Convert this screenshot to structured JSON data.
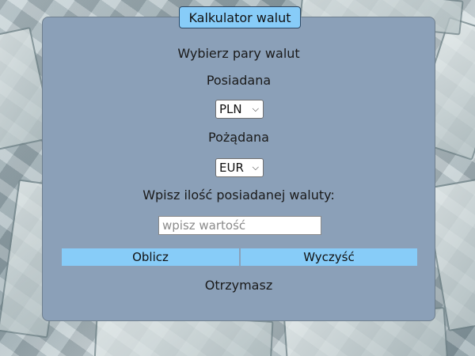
{
  "app": {
    "title": "Kalkulator walut"
  },
  "form": {
    "heading": "Wybierz pary walut",
    "have_label": "Posiadana",
    "have_value": "PLN",
    "want_label": "Pożądana",
    "want_value": "EUR",
    "amount_label": "Wpisz ilość posiadanej waluty:",
    "amount_placeholder": "wpisz wartość",
    "amount_value": "",
    "calc_button": "Oblicz",
    "clear_button": "Wyczyść",
    "result_label": "Otrzymasz"
  },
  "icons": {
    "select_chevron": "chevron-down-icon"
  },
  "colors": {
    "card": "#8ba0b8",
    "accent": "#87ccf8"
  }
}
